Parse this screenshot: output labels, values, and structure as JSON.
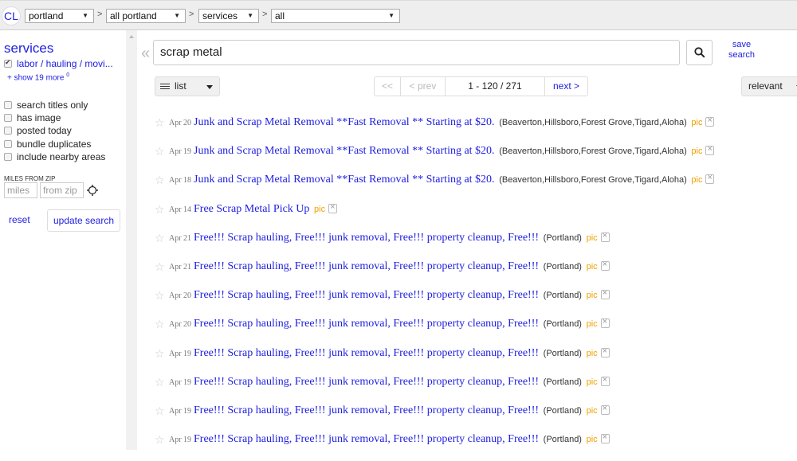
{
  "topbar": {
    "logo": "CL",
    "crumbs": [
      {
        "value": "portland"
      },
      {
        "value": "all portland"
      },
      {
        "value": "services"
      },
      {
        "value": "all"
      }
    ],
    "separator": ">"
  },
  "sidebar": {
    "title": "services",
    "category": {
      "label": "labor / hauling / movi...",
      "checked": true
    },
    "show_more": "+ show 19 more",
    "show_more_count": "0",
    "options": [
      {
        "label": "search titles only",
        "checked": false
      },
      {
        "label": "has image",
        "checked": false
      },
      {
        "label": "posted today",
        "checked": false
      },
      {
        "label": "bundle duplicates",
        "checked": false
      },
      {
        "label": "include nearby areas",
        "checked": false
      }
    ],
    "miles_label": "MILES FROM ZIP",
    "miles_placeholder": "miles",
    "zip_placeholder": "from zip",
    "reset": "reset",
    "update": "update search"
  },
  "search": {
    "query": "scrap metal",
    "collapse_icon": "«",
    "save_line1": "save",
    "save_line2": "search"
  },
  "toolbar": {
    "view": "list",
    "pager": {
      "first": "<<",
      "prev": "< prev",
      "range": "1 - 120 / 271",
      "next": "next >"
    },
    "sort": "relevant"
  },
  "results": [
    {
      "date": "Apr 20",
      "title": "Junk and Scrap Metal Removal **Fast Removal ** Starting at $20.",
      "hood": "(Beaverton,Hillsboro,Forest Grove,Tigard,Aloha)",
      "pic": "pic"
    },
    {
      "date": "Apr 19",
      "title": "Junk and Scrap Metal Removal **Fast Removal ** Starting at $20.",
      "hood": "(Beaverton,Hillsboro,Forest Grove,Tigard,Aloha)",
      "pic": "pic"
    },
    {
      "date": "Apr 18",
      "title": "Junk and Scrap Metal Removal **Fast Removal ** Starting at $20.",
      "hood": "(Beaverton,Hillsboro,Forest Grove,Tigard,Aloha)",
      "pic": "pic"
    },
    {
      "date": "Apr 14",
      "title": "Free Scrap Metal Pick Up",
      "hood": "",
      "pic": "pic"
    },
    {
      "date": "Apr 21",
      "title": "Free!!! Scrap hauling, Free!!! junk removal, Free!!! property cleanup, Free!!!",
      "hood": "(Portland)",
      "pic": "pic"
    },
    {
      "date": "Apr 21",
      "title": "Free!!! Scrap hauling, Free!!! junk removal, Free!!! property cleanup, Free!!!",
      "hood": "(Portland)",
      "pic": "pic"
    },
    {
      "date": "Apr 20",
      "title": "Free!!! Scrap hauling, Free!!! junk removal, Free!!! property cleanup, Free!!!",
      "hood": "(Portland)",
      "pic": "pic"
    },
    {
      "date": "Apr 20",
      "title": "Free!!! Scrap hauling, Free!!! junk removal, Free!!! property cleanup, Free!!!",
      "hood": "(Portland)",
      "pic": "pic"
    },
    {
      "date": "Apr 19",
      "title": "Free!!! Scrap hauling, Free!!! junk removal, Free!!! property cleanup, Free!!!",
      "hood": "(Portland)",
      "pic": "pic"
    },
    {
      "date": "Apr 19",
      "title": "Free!!! Scrap hauling, Free!!! junk removal, Free!!! property cleanup, Free!!!",
      "hood": "(Portland)",
      "pic": "pic"
    },
    {
      "date": "Apr 19",
      "title": "Free!!! Scrap hauling, Free!!! junk removal, Free!!! property cleanup, Free!!!",
      "hood": "(Portland)",
      "pic": "pic"
    },
    {
      "date": "Apr 19",
      "title": "Free!!! Scrap hauling, Free!!! junk removal, Free!!! property cleanup, Free!!!",
      "hood": "(Portland)",
      "pic": "pic"
    }
  ],
  "colors": {
    "link": "#2020e0",
    "pic": "#f0a000",
    "topbar_bg": "#eeeeee"
  }
}
